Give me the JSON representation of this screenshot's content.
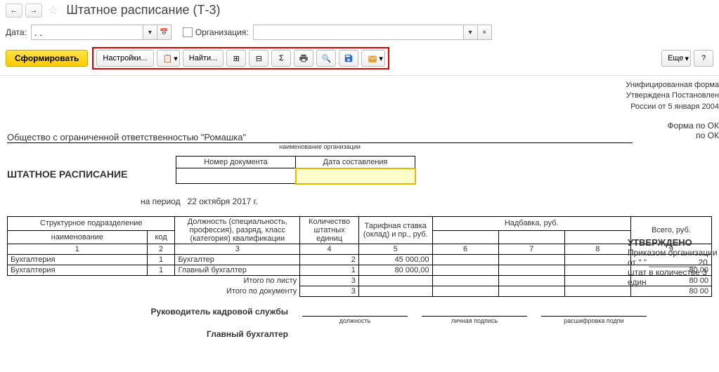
{
  "header": {
    "title": "Штатное расписание (Т-3)"
  },
  "filter": {
    "date_label": "Дата:",
    "date_value": ". .",
    "org_label": "Организация:",
    "org_value": ""
  },
  "toolbar": {
    "form": "Сформировать",
    "settings": "Настройки...",
    "find": "Найти...",
    "more": "Еще"
  },
  "report": {
    "unified_form": "Унифицированная форма",
    "approved_by": "Утверждена Постановлен",
    "russia_date": "России от 5 января 2004",
    "form_by_ok": "Форма по ОК",
    "by_ok": "по ОК",
    "org_name": "Общество с ограниченной ответственностью \"Ромашка\"",
    "org_caption": "наименование организации",
    "doc_title": "ШТАТНОЕ РАСПИСАНИЕ",
    "num_header": "Номер документа",
    "date_header": "Дата составления",
    "period_label": "на период",
    "period_value": "22 октября 2017 г.",
    "approved_title": "УТВЕРЖДЕНО",
    "approved_order": "Приказом организации",
    "approved_from": "от \"     \" __________ 20",
    "approved_staff": "штат в количестве 3 един"
  },
  "table": {
    "head": {
      "subdiv": "Структурное  подразделение",
      "subdiv_name": "наименование",
      "subdiv_code": "код",
      "position": "Должность (специальность, профессия), разряд, класс (категория) квалификации",
      "count": "Количество штатных единиц",
      "rate": "Тарифная ставка (оклад) и пр., руб.",
      "allowance": "Надбавка, руб.",
      "total": "Всего, руб.",
      "n1": "1",
      "n2": "2",
      "n3": "3",
      "n4": "4",
      "n5": "5",
      "n6": "6",
      "n7": "7",
      "n8": "8",
      "n9": "9"
    },
    "rows": [
      {
        "name": "Бухгалтерия",
        "code": "1",
        "pos": "Бухгалтер",
        "cnt": "2",
        "rate": "45 000,00",
        "a1": "",
        "a2": "",
        "a3": "",
        "total": ""
      },
      {
        "name": "Бухгалтерия",
        "code": "1",
        "pos": "Главный бухгалтер",
        "cnt": "1",
        "rate": "80 000,00",
        "a1": "",
        "a2": "",
        "a3": "",
        "total": "80 00"
      }
    ],
    "totals": {
      "sheet_label": "Итого по листу",
      "doc_label": "Итого по документу",
      "sheet_cnt": "3",
      "doc_cnt": "3",
      "sheet_total": "80 00",
      "doc_total": "80 00"
    }
  },
  "signatures": {
    "hr_head": "Руководитель кадровой службы",
    "chief_acc": "Главный бухгалтер",
    "pos_caption": "должность",
    "sign_caption": "личная подпись",
    "name_caption": "расшифровка  подпи"
  }
}
